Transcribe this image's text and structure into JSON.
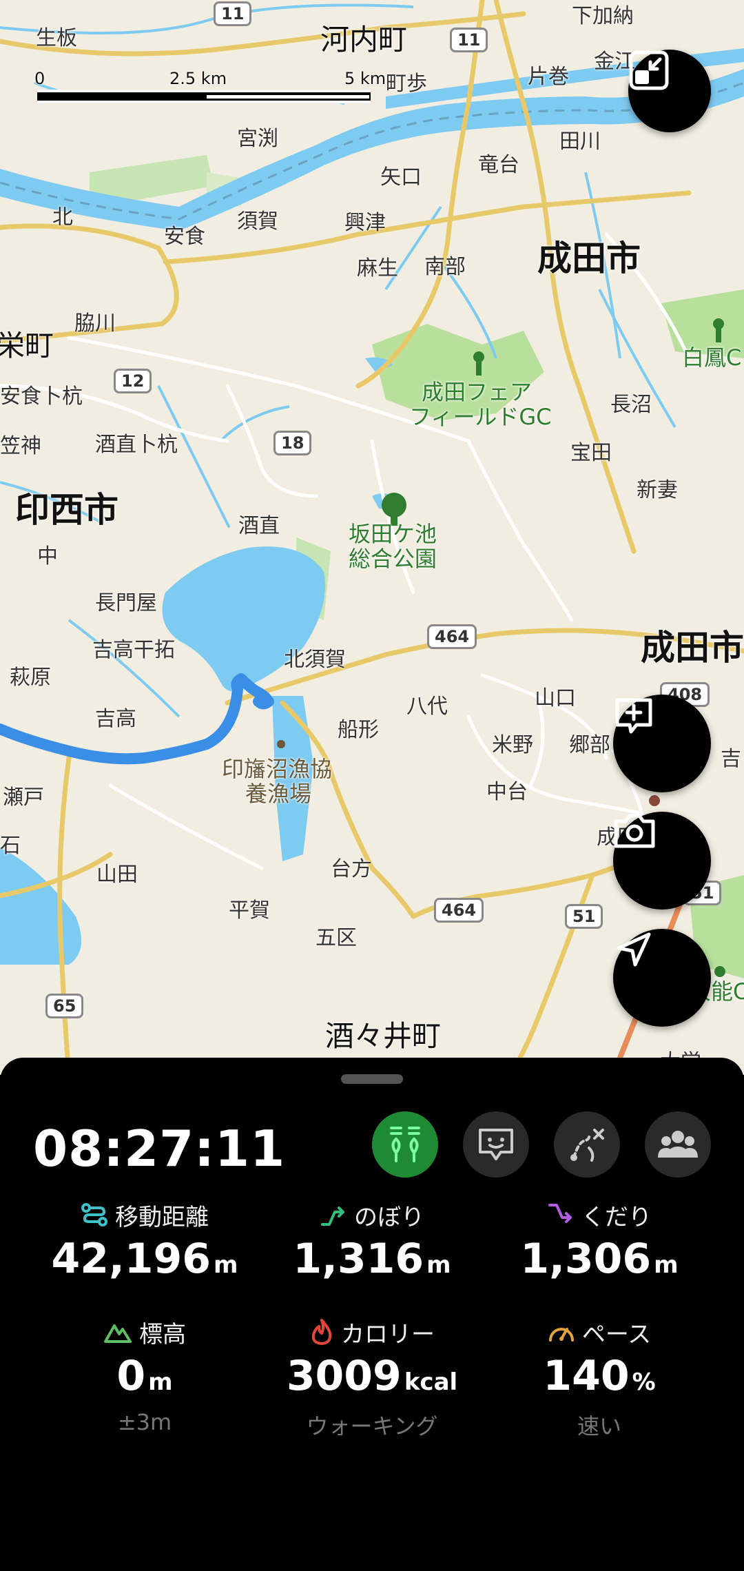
{
  "map": {
    "scale": {
      "zero": "0",
      "mid": "2.5 km",
      "end": "5 km"
    },
    "roads": [
      "11",
      "11",
      "12",
      "18",
      "464",
      "408",
      "464",
      "51",
      "65",
      "51"
    ],
    "places": {
      "kawachi": "河内町",
      "shimokanou": "下加納",
      "kanae": "金江",
      "katamaki": "片巻",
      "taguchi": "田川",
      "namaiba": "生板",
      "chohochou": "町歩",
      "miyabuchi": "宮渕",
      "yaguchi": "矢口",
      "ryudai": "竜台",
      "kita": "北",
      "anjiki": "安食",
      "suka": "須賀",
      "okitsu": "興津",
      "asou": "麻生",
      "nanbu": "南部",
      "narita_city": "成田市",
      "sakaemachi": "栄町",
      "wakigawa": "脇川",
      "hakuho": "白鳳C",
      "narita_fair_1": "成田フェア",
      "narita_fair_2": "フィールドGC",
      "naganuma": "長沼",
      "anjikitoko": "安食卜杭",
      "kasagami": "笠神",
      "sakanaotoko": "酒直卜杭",
      "takada": "宝田",
      "inzai_city": "印西市",
      "sakanao": "酒直",
      "sakatagaike_1": "坂田ケ池",
      "sakatagaike_2": "総合公園",
      "shinzuma": "新妻",
      "naka": "中",
      "nagatoya": "長門屋",
      "yoshitaka_hitaku": "吉高干拓",
      "kitasuka": "北須賀",
      "narita_city_2": "成田市",
      "hagihara": "萩原",
      "yoshitaka": "吉高",
      "yashiro": "八代",
      "yamaguchi": "山口",
      "funagata": "船形",
      "yoneno": "米野",
      "gobu": "郷部",
      "yoshi": "吉",
      "gyokyo_1": "印旛沼漁協",
      "gyokyo_2": "養漁場",
      "nakadai": "中台",
      "narita_short": "成田新",
      "seto": "瀬戸",
      "daikata": "台方",
      "yamada": "山田",
      "hiraka": "平賀",
      "goku": "五区",
      "shisuimachi": "酒々井町",
      "noh": "大能C",
      "ishi": "石",
      "hyakugaku": "大学"
    }
  },
  "buttons": {
    "collapse_map": "collapse-map-icon",
    "add_memo": "add-memo-icon",
    "camera": "camera-icon",
    "locate": "navigation-arrow-icon"
  },
  "panel": {
    "elapsed_time": "08:27:11",
    "mode_buttons": [
      "walking-mode-icon",
      "chat-face-icon",
      "route-off-icon",
      "group-icon"
    ],
    "stats": {
      "distance": {
        "label": "移動距離",
        "value": "42,196",
        "unit": "m"
      },
      "ascent": {
        "label": "のぼり",
        "value": "1,316",
        "unit": "m"
      },
      "descent": {
        "label": "くだり",
        "value": "1,306",
        "unit": "m"
      },
      "elevation": {
        "label": "標高",
        "value": "0",
        "unit": "m",
        "sub": "±3m"
      },
      "calories": {
        "label": "カロリー",
        "value": "3009",
        "unit": "kcal",
        "sub": "ウォーキング"
      },
      "pace": {
        "label": "ペース",
        "value": "140",
        "unit": "%",
        "sub": "速い"
      }
    }
  },
  "colors": {
    "track": "#3a8ee6",
    "water": "#7ecbf1",
    "active_mode": "#1f8a34",
    "distance_icon": "#3ec2c9",
    "ascent_icon": "#2fc07a",
    "descent_icon": "#b45be6",
    "elevation_icon": "#5fbf63",
    "calorie_icon": "#e6463a",
    "pace_icon": "#e6a23a"
  }
}
